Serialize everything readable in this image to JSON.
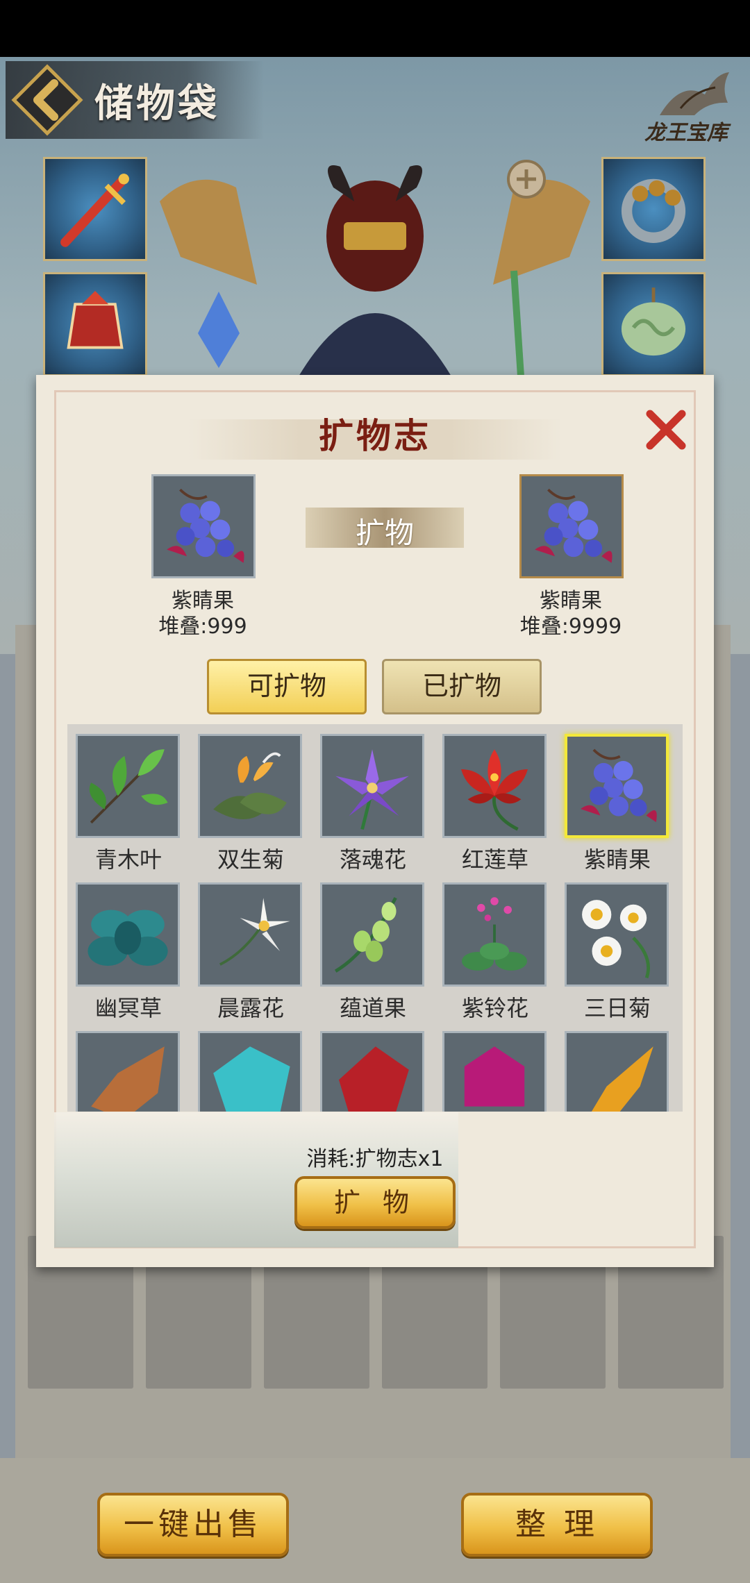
{
  "header": {
    "title": "储物袋",
    "logo_text": "龙王宝库"
  },
  "modal": {
    "title": "扩物志",
    "source_item": {
      "name": "紫睛果",
      "stack": "堆叠:999"
    },
    "arrow_label": "扩物",
    "target_item": {
      "name": "紫睛果",
      "stack": "堆叠:9999"
    },
    "tabs": [
      {
        "label": "可扩物",
        "active": true
      },
      {
        "label": "已扩物",
        "active": false
      }
    ],
    "grid_items": [
      {
        "name": "青木叶",
        "icon": "green-leaf-icon"
      },
      {
        "name": "双生菊",
        "icon": "orange-lily-icon"
      },
      {
        "name": "落魂花",
        "icon": "purple-flower-icon"
      },
      {
        "name": "红莲草",
        "icon": "red-lotus-icon"
      },
      {
        "name": "紫睛果",
        "icon": "purple-berries-icon",
        "selected": true
      },
      {
        "name": "幽冥草",
        "icon": "teal-flower-icon"
      },
      {
        "name": "晨露花",
        "icon": "white-lily-icon"
      },
      {
        "name": "蕴道果",
        "icon": "green-fruit-icon"
      },
      {
        "name": "紫铃花",
        "icon": "pink-bell-flower-icon"
      },
      {
        "name": "三日菊",
        "icon": "daisy-icon"
      },
      {
        "name": "",
        "icon": "brown-ore-icon"
      },
      {
        "name": "",
        "icon": "cyan-crystal-icon"
      },
      {
        "name": "",
        "icon": "red-crystal-icon"
      },
      {
        "name": "",
        "icon": "magenta-gem-icon"
      },
      {
        "name": "",
        "icon": "amber-shard-icon"
      }
    ],
    "cost_text": "消耗:扩物志x1",
    "confirm_label": "扩 物"
  },
  "bottom": {
    "sell_all_label": "一键出售",
    "sort_label": "整 理"
  },
  "colors": {
    "accent_gold": "#f0c048",
    "title_red": "#7a1e12",
    "close_red": "#c8342a",
    "selected_border": "#f3e83a"
  }
}
